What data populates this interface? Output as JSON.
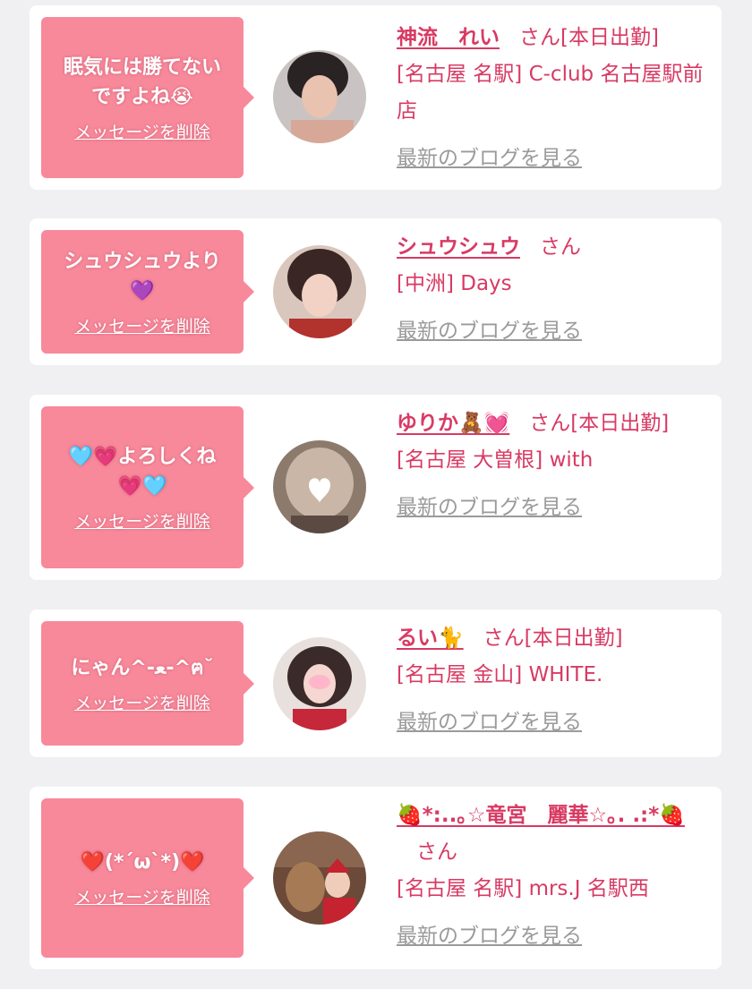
{
  "colors": {
    "background": "#f0f0f2",
    "card": "#ffffff",
    "bubble": "#f7899a",
    "accent": "#d83a63",
    "link_gray": "#9a9a9a"
  },
  "delete_label": "メッセージを削除",
  "blog_label": "最新のブログを見る",
  "san_label": "さん",
  "cards": [
    {
      "message": "眠気には勝てない\nですよね😭",
      "name": "神流　れい",
      "status": "[本日出勤]",
      "shop": "[名古屋 名駅] C-club 名古屋駅前店",
      "avatar_icon": "profile-photo"
    },
    {
      "message": "シュウシュウより\n💜",
      "name": "シュウシュウ",
      "status": "",
      "shop": "[中洲] Days",
      "avatar_icon": "profile-photo"
    },
    {
      "message": "🩵💗よろしくね\n💗🩵",
      "name": "ゆりか🧸💓",
      "status": "[本日出勤]",
      "shop": "[名古屋 大曽根] with",
      "avatar_icon": "profile-photo"
    },
    {
      "message": "にゃん^-ﻌ-^ฅ˘",
      "name": "るい🐈",
      "status": "[本日出勤]",
      "shop": "[名古屋 金山] WHITE.",
      "avatar_icon": "profile-photo"
    },
    {
      "message": "❤️(*´ω`*)❤️",
      "name": "🍓*:..｡☆竜宮　麗華☆｡. .:*🍓",
      "status": "",
      "shop": "[名古屋 名駅] mrs.J 名駅西",
      "avatar_icon": "profile-photo"
    }
  ]
}
